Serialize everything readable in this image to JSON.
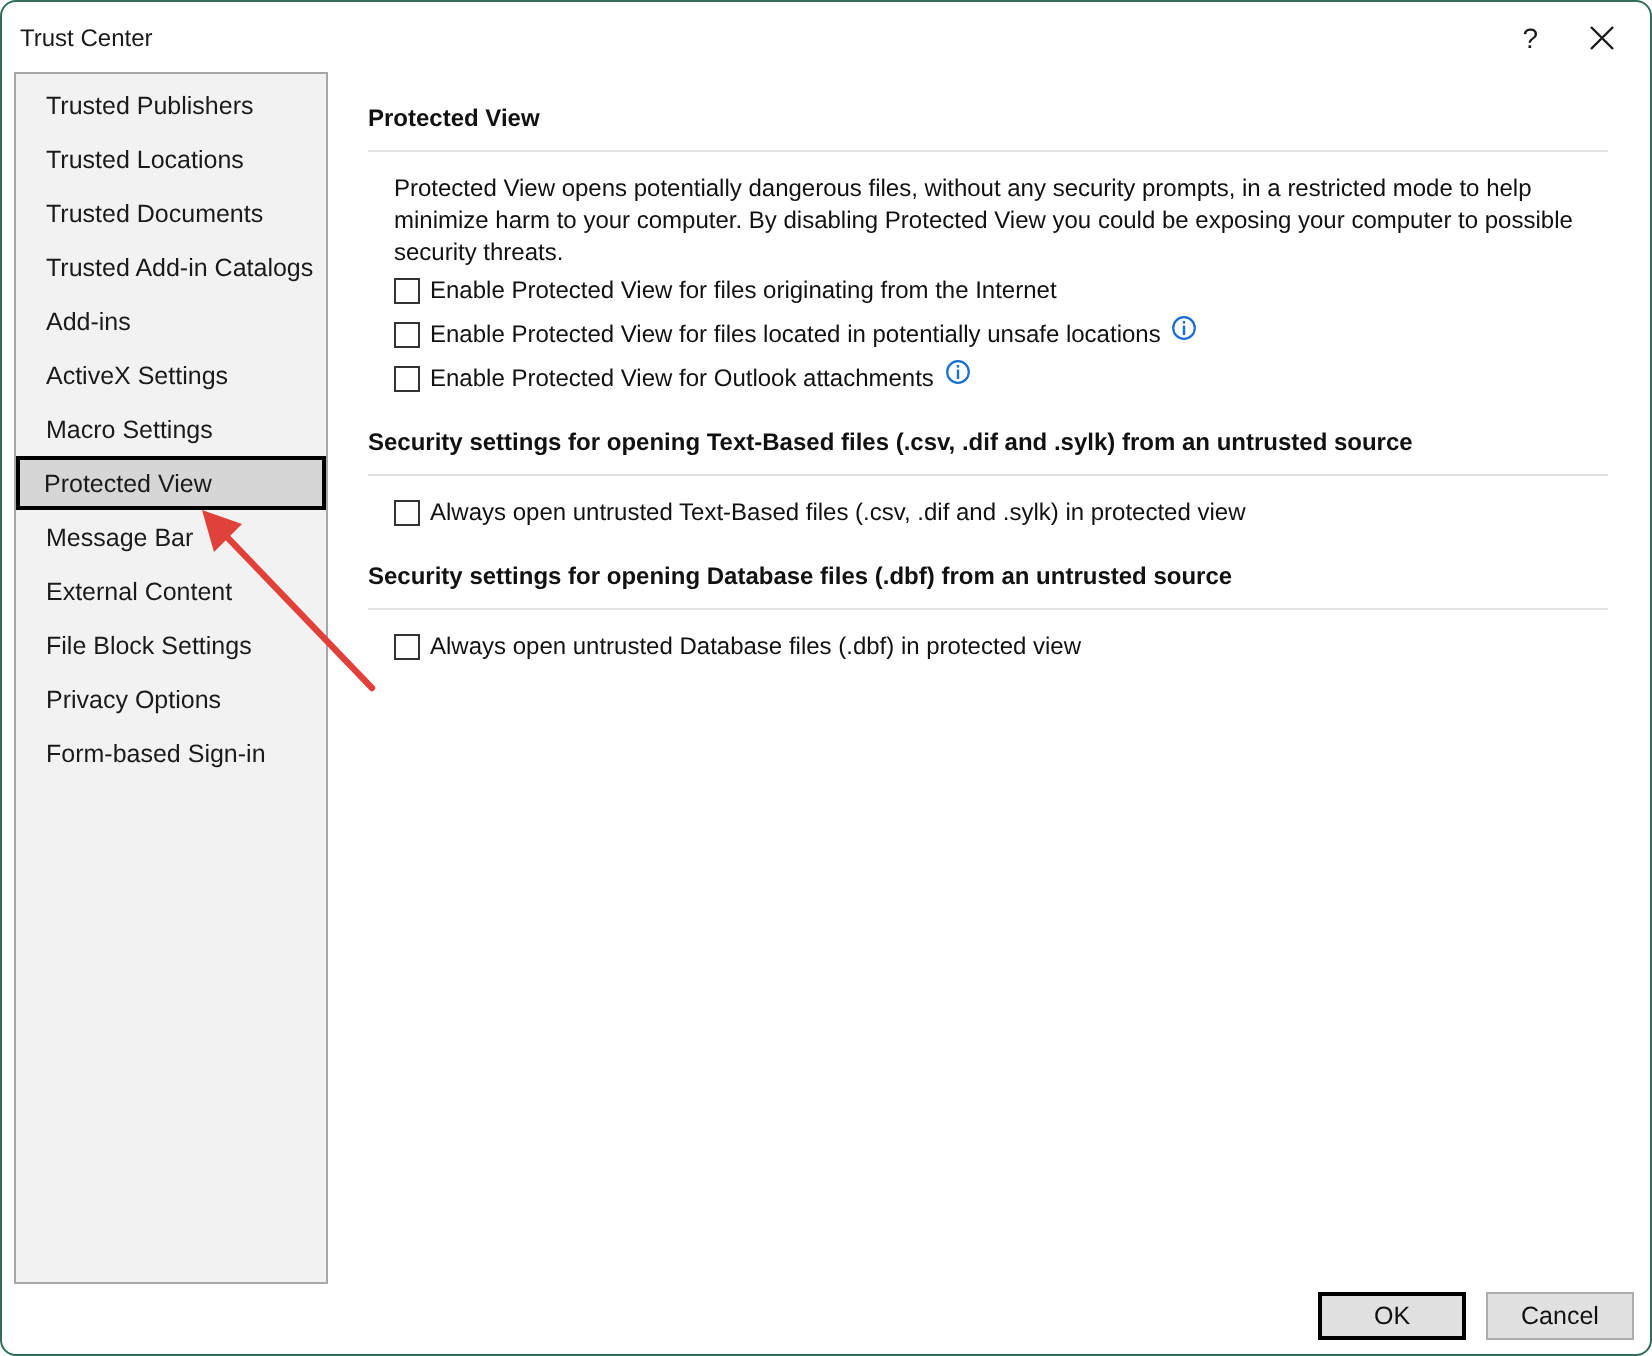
{
  "window": {
    "title": "Trust Center",
    "help_button": "?"
  },
  "sidebar": {
    "items": [
      {
        "label": "Trusted Publishers",
        "selected": false
      },
      {
        "label": "Trusted Locations",
        "selected": false
      },
      {
        "label": "Trusted Documents",
        "selected": false
      },
      {
        "label": "Trusted Add-in Catalogs",
        "selected": false
      },
      {
        "label": "Add-ins",
        "selected": false
      },
      {
        "label": "ActiveX Settings",
        "selected": false
      },
      {
        "label": "Macro Settings",
        "selected": false
      },
      {
        "label": "Protected View",
        "selected": true
      },
      {
        "label": "Message Bar",
        "selected": false
      },
      {
        "label": "External Content",
        "selected": false
      },
      {
        "label": "File Block Settings",
        "selected": false
      },
      {
        "label": "Privacy Options",
        "selected": false
      },
      {
        "label": "Form-based Sign-in",
        "selected": false
      }
    ]
  },
  "sections": [
    {
      "heading": "Protected View",
      "description": "Protected View opens potentially dangerous files, without any security prompts, in a restricted mode to help minimize harm to your computer. By disabling Protected View you could be exposing your computer to possible security threats.",
      "options": [
        {
          "label": "Enable Protected View for files originating from the Internet",
          "checked": false,
          "info": false
        },
        {
          "label": "Enable Protected View for files located in potentially unsafe locations",
          "checked": false,
          "info": true
        },
        {
          "label": "Enable Protected View for Outlook attachments",
          "checked": false,
          "info": true
        }
      ]
    },
    {
      "heading": "Security settings for opening Text-Based files (.csv, .dif and .sylk) from an untrusted source",
      "options": [
        {
          "label": "Always open untrusted Text-Based files (.csv, .dif and .sylk) in protected view",
          "checked": false,
          "info": false
        }
      ]
    },
    {
      "heading": "Security settings for opening Database files (.dbf) from an untrusted source",
      "options": [
        {
          "label": "Always open untrusted Database files (.dbf) in protected view",
          "checked": false,
          "info": false
        }
      ]
    }
  ],
  "buttons": [
    {
      "label": "OK",
      "default": true
    },
    {
      "label": "Cancel",
      "default": false
    }
  ]
}
